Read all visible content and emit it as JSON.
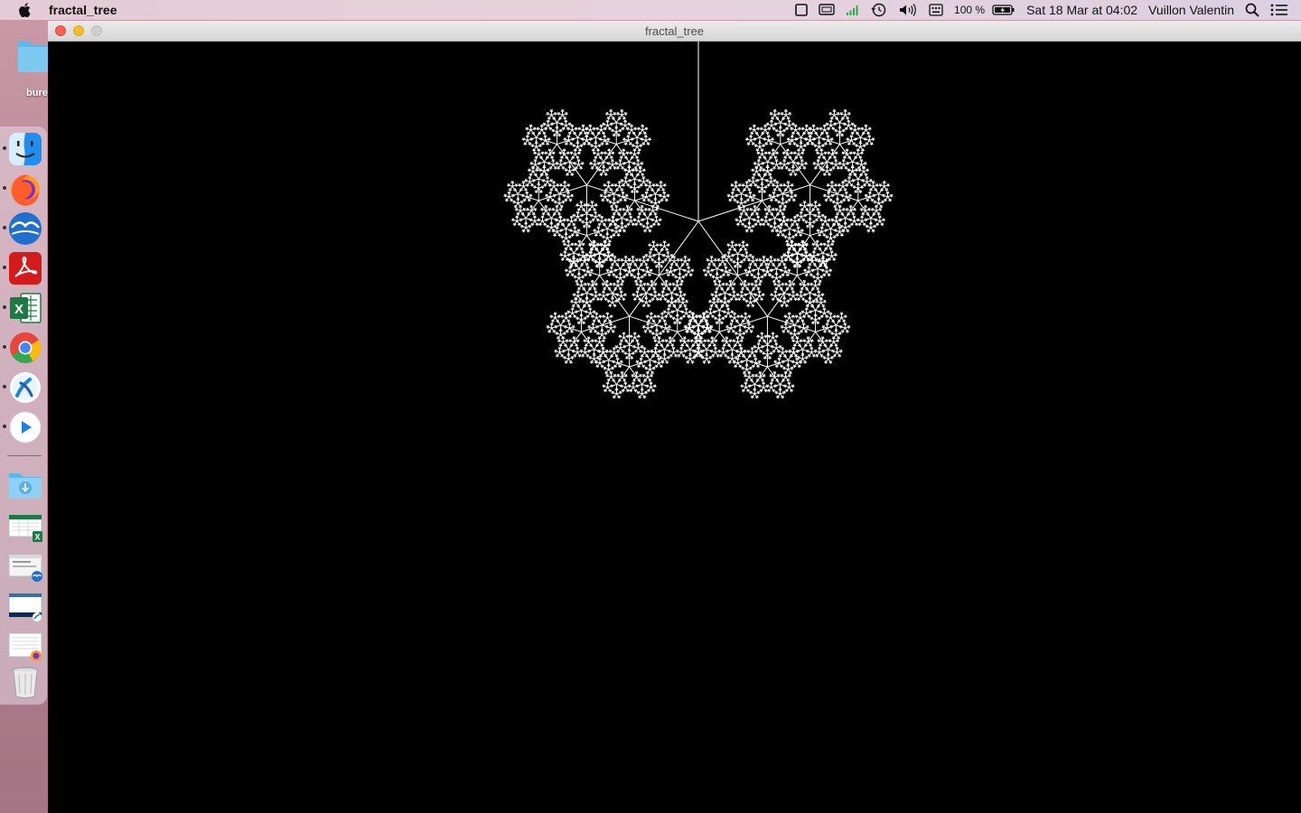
{
  "menubar": {
    "app_name": "fractal_tree",
    "battery_percent": "100 %",
    "datetime": "Sat 18 Mar at  04:02",
    "user_name": "Vuillon Valentin",
    "icons": [
      "apple-icon",
      "window-icon",
      "display-icon",
      "wifi-bars-icon",
      "time-machine-icon",
      "volume-icon",
      "keyboard-icon",
      "battery-icon",
      "spotlight-icon",
      "control-center-icon"
    ]
  },
  "desktop": {
    "folder_label": "bure"
  },
  "dock": {
    "apps": [
      "finder-icon",
      "firefox-icon",
      "openoffice-icon",
      "acrobat-icon",
      "excel-icon",
      "chrome-icon",
      "xcode-icon",
      "quicktime-icon"
    ],
    "others": [
      "downloads-folder-icon",
      "excel-window-thumb",
      "openoffice-window-thumb",
      "xcode-window-thumb",
      "firefox-window-thumb",
      "trash-icon"
    ]
  },
  "window": {
    "title": "fractal_tree",
    "fractal": {
      "branches": 5,
      "depth": 6,
      "color": "#ffffff",
      "background": "#000000"
    }
  }
}
